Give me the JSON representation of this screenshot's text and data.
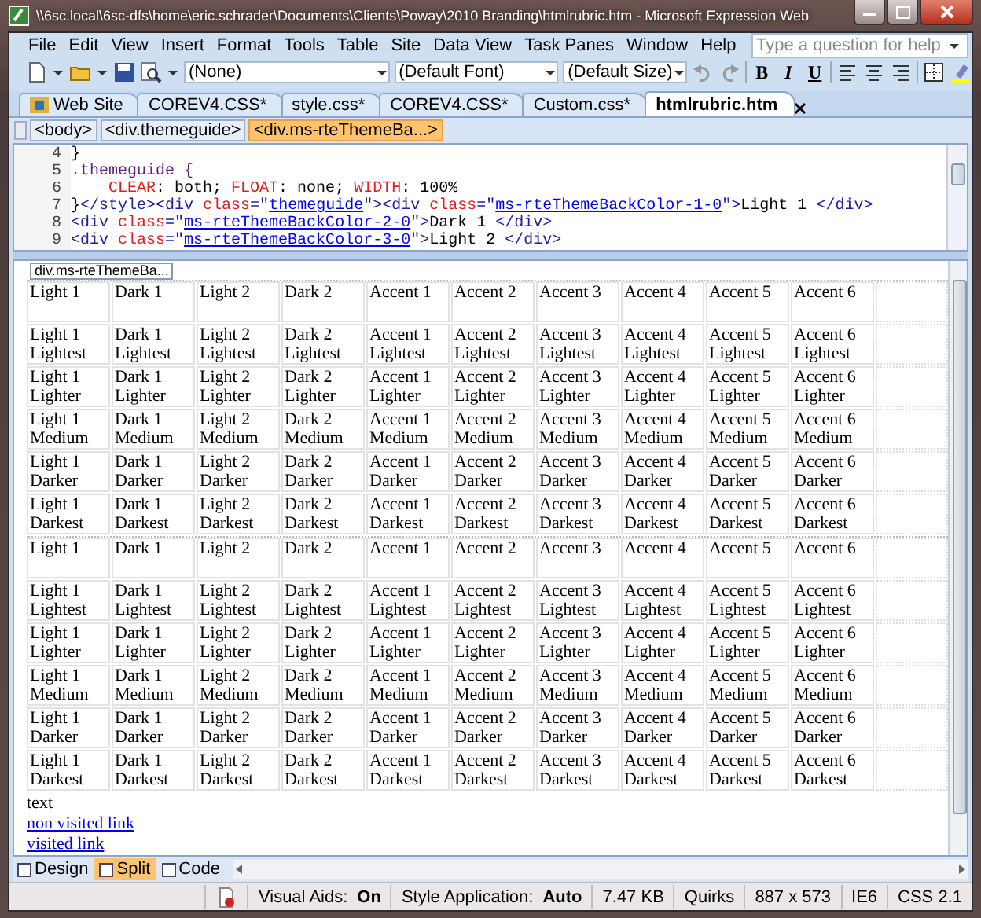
{
  "window": {
    "title": "\\\\6sc.local\\6sc-dfs\\home\\eric.schrader\\Documents\\Clients\\Poway\\2010 Branding\\htmlrubric.htm - Microsoft Expression Web"
  },
  "menu": [
    "File",
    "Edit",
    "View",
    "Insert",
    "Format",
    "Tools",
    "Table",
    "Site",
    "Data View",
    "Task Panes",
    "Window",
    "Help"
  ],
  "help_search": {
    "placeholder": "Type a question for help"
  },
  "toolbar": {
    "style": "(None)",
    "font": "(Default Font)",
    "size": "(Default Size)",
    "bold": "B",
    "italic": "I",
    "underline": "U"
  },
  "tabs": [
    {
      "label": "Web Site",
      "selected": false
    },
    {
      "label": "COREV4.CSS*",
      "selected": false
    },
    {
      "label": "style.css*",
      "selected": false
    },
    {
      "label": "COREV4.CSS*",
      "selected": false
    },
    {
      "label": "Custom.css*",
      "selected": false
    },
    {
      "label": "htmlrubric.htm",
      "selected": true
    }
  ],
  "breadcrumb": [
    {
      "label": "<body>",
      "selected": false
    },
    {
      "label": "<div.themeguide>",
      "selected": false
    },
    {
      "label": "<div.ms-rteThemeBa...>",
      "selected": true
    }
  ],
  "code": {
    "lines": [
      {
        "number": "4",
        "tokens": [
          {
            "kind": "text",
            "text": "}"
          }
        ]
      },
      {
        "number": "5",
        "tokens": [
          {
            "kind": "selector",
            "text": ".themeguide {"
          }
        ]
      },
      {
        "number": "6",
        "indented": true,
        "tokens": [
          {
            "kind": "prop",
            "text": "CLEAR"
          },
          {
            "kind": "text",
            "text": ": both; "
          },
          {
            "kind": "prop",
            "text": "FLOAT"
          },
          {
            "kind": "text",
            "text": ": none; "
          },
          {
            "kind": "prop",
            "text": "WIDTH"
          },
          {
            "kind": "text",
            "text": ": 100%"
          }
        ]
      },
      {
        "number": "7",
        "tokens": [
          {
            "kind": "text",
            "text": "}"
          },
          {
            "kind": "tag",
            "text": "</style><div"
          },
          {
            "kind": "attr",
            "text": " class"
          },
          {
            "kind": "tag",
            "text": "=\""
          },
          {
            "kind": "value",
            "text": "themeguide"
          },
          {
            "kind": "tag",
            "text": "\"><div"
          },
          {
            "kind": "attr",
            "text": " class"
          },
          {
            "kind": "tag",
            "text": "=\""
          },
          {
            "kind": "value",
            "text": "ms-rteThemeBackColor-1-0"
          },
          {
            "kind": "tag",
            "text": "\">"
          },
          {
            "kind": "text",
            "text": "Light 1 "
          },
          {
            "kind": "tag",
            "text": "</div>"
          }
        ]
      },
      {
        "number": "8",
        "tokens": [
          {
            "kind": "tag",
            "text": "<div"
          },
          {
            "kind": "attr",
            "text": " class"
          },
          {
            "kind": "tag",
            "text": "=\""
          },
          {
            "kind": "value",
            "text": "ms-rteThemeBackColor-2-0"
          },
          {
            "kind": "tag",
            "text": "\">"
          },
          {
            "kind": "text",
            "text": "Dark 1 "
          },
          {
            "kind": "tag",
            "text": "</div>"
          }
        ]
      },
      {
        "number": "9",
        "tokens": [
          {
            "kind": "tag",
            "text": "<div"
          },
          {
            "kind": "attr",
            "text": " class"
          },
          {
            "kind": "tag",
            "text": "=\""
          },
          {
            "kind": "value",
            "text": "ms-rteThemeBackColor-3-0"
          },
          {
            "kind": "tag",
            "text": "\">"
          },
          {
            "kind": "text",
            "text": "Light 2 "
          },
          {
            "kind": "tag",
            "text": "</div>"
          }
        ]
      }
    ]
  },
  "design": {
    "tag_label": "div.ms-rteThemeBa...",
    "tables": [
      {
        "rows": [
          [
            "Light 1",
            "Dark 1",
            "Light 2",
            "Dark 2",
            "Accent 1",
            "Accent 2",
            "Accent 3",
            "Accent 4",
            "Accent 5",
            "Accent 6"
          ],
          [
            "Light 1 Lightest",
            "Dark 1 Lightest",
            "Light 2 Lightest",
            "Dark 2 Lightest",
            "Accent 1 Lightest",
            "Accent 2 Lightest",
            "Accent 3 Lightest",
            "Accent 4 Lightest",
            "Accent 5 Lightest",
            "Accent 6 Lightest"
          ],
          [
            "Light 1 Lighter",
            "Dark 1 Lighter",
            "Light 2 Lighter",
            "Dark 2 Lighter",
            "Accent 1 Lighter",
            "Accent 2 Lighter",
            "Accent 3 Lighter",
            "Accent 4 Lighter",
            "Accent 5 Lighter",
            "Accent 6 Lighter"
          ],
          [
            "Light 1 Medium",
            "Dark 1 Medium",
            "Light 2 Medium",
            "Dark 2 Medium",
            "Accent 1 Medium",
            "Accent 2 Medium",
            "Accent 3 Medium",
            "Accent 4 Medium",
            "Accent 5 Medium",
            "Accent 6 Medium"
          ],
          [
            "Light 1 Darker",
            "Dark 1 Darker",
            "Light 2 Darker",
            "Dark 2 Darker",
            "Accent 1 Darker",
            "Accent 2 Darker",
            "Accent 3 Darker",
            "Accent 4 Darker",
            "Accent 5 Darker",
            "Accent 6 Darker"
          ],
          [
            "Light 1 Darkest",
            "Dark 1 Darkest",
            "Light 2 Darkest",
            "Dark 2 Darkest",
            "Accent 1 Darkest",
            "Accent 2 Darkest",
            "Accent 3 Darkest",
            "Accent 4 Darkest",
            "Accent 5 Darkest",
            "Accent 6 Darkest"
          ]
        ]
      },
      {
        "rows": [
          [
            "Light 1",
            "Dark 1",
            "Light 2",
            "Dark 2",
            "Accent 1",
            "Accent 2",
            "Accent 3",
            "Accent 4",
            "Accent 5",
            "Accent 6"
          ],
          [
            "Light 1 Lightest",
            "Dark 1 Lightest",
            "Light 2 Lightest",
            "Dark 2 Lightest",
            "Accent 1 Lightest",
            "Accent 2 Lightest",
            "Accent 3 Lightest",
            "Accent 4 Lightest",
            "Accent 5 Lightest",
            "Accent 6 Lightest"
          ],
          [
            "Light 1 Lighter",
            "Dark 1 Lighter",
            "Light 2 Lighter",
            "Dark 2 Lighter",
            "Accent 1 Lighter",
            "Accent 2 Lighter",
            "Accent 3 Lighter",
            "Accent 4 Lighter",
            "Accent 5 Lighter",
            "Accent 6 Lighter"
          ],
          [
            "Light 1 Medium",
            "Dark 1 Medium",
            "Light 2 Medium",
            "Dark 2 Medium",
            "Accent 1 Medium",
            "Accent 2 Medium",
            "Accent 3 Medium",
            "Accent 4 Medium",
            "Accent 5 Medium",
            "Accent 6 Medium"
          ],
          [
            "Light 1 Darker",
            "Dark 1 Darker",
            "Light 2 Darker",
            "Dark 2 Darker",
            "Accent 1 Darker",
            "Accent 2 Darker",
            "Accent 3 Darker",
            "Accent 4 Darker",
            "Accent 5 Darker",
            "Accent 6 Darker"
          ],
          [
            "Light 1 Darkest",
            "Dark 1 Darkest",
            "Light 2 Darkest",
            "Dark 2 Darkest",
            "Accent 1 Darkest",
            "Accent 2 Darkest",
            "Accent 3 Darkest",
            "Accent 4 Darkest",
            "Accent 5 Darkest",
            "Accent 6 Darkest"
          ]
        ]
      }
    ],
    "paragraph": "text",
    "links": [
      "non visited link",
      "visited link"
    ]
  },
  "view_tabs": [
    {
      "label": "Design",
      "selected": false
    },
    {
      "label": "Split",
      "selected": true
    },
    {
      "label": "Code",
      "selected": false
    }
  ],
  "status_bar": {
    "visual_aids_label": "Visual Aids:",
    "visual_aids": "On",
    "style_label": "Style Application:",
    "style": "Auto",
    "size": "7.47 KB",
    "mode": "Quirks",
    "dimensions": "887 x 573",
    "browser": "IE6",
    "css": "CSS 2.1"
  }
}
